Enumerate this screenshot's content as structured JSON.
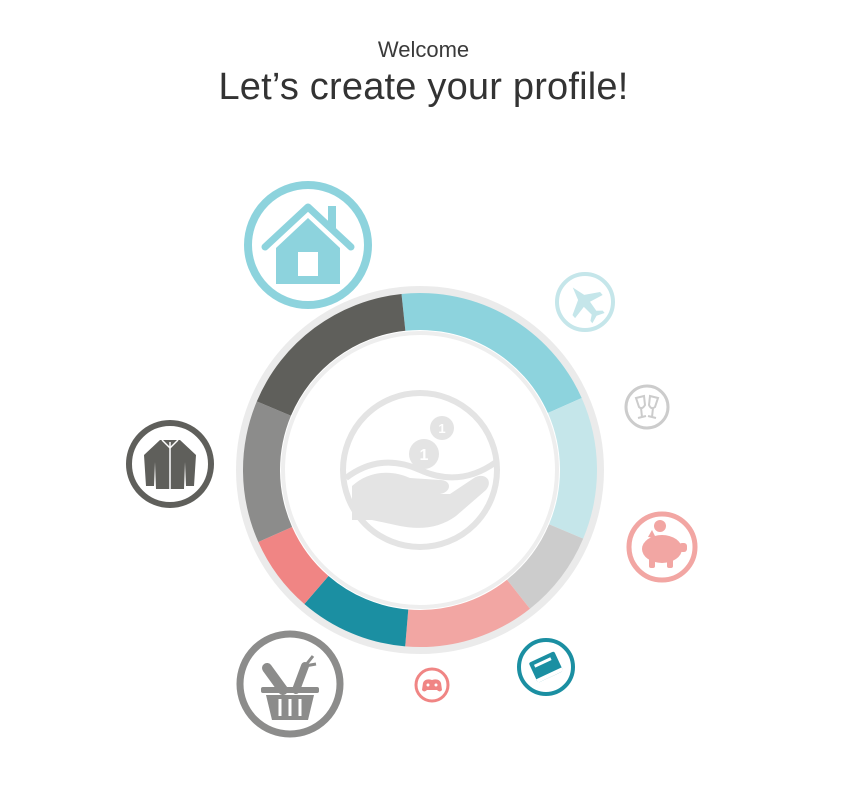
{
  "header": {
    "welcome": "Welcome",
    "title": "Let’s create your profile!"
  },
  "colors": {
    "teal_light": "#8dd3dd",
    "teal_pale": "#c5e6ea",
    "gray_pale": "#cccccc",
    "salmon_light": "#f2a6a3",
    "teal_dark": "#1b8fa2",
    "salmon": "#f08584",
    "gray_mid": "#8c8c8b",
    "gray_dark": "#5f5f5b",
    "ring_track": "#ebebeb",
    "center_icon": "#e4e4e4"
  },
  "categories": [
    {
      "name": "housing",
      "icon": "house-icon",
      "color": "#8dd3dd",
      "share": 0.2
    },
    {
      "name": "travel",
      "icon": "airplane-icon",
      "color": "#c5e6ea",
      "share": 0.13
    },
    {
      "name": "going-out",
      "icon": "champagne-glasses-icon",
      "color": "#cccccc",
      "share": 0.08
    },
    {
      "name": "savings",
      "icon": "piggy-bank-icon",
      "color": "#f2a6a3",
      "share": 0.12
    },
    {
      "name": "education",
      "icon": "book-icon",
      "color": "#1b8fa2",
      "share": 0.1
    },
    {
      "name": "games",
      "icon": "gamepad-icon",
      "color": "#f08584",
      "share": 0.07
    },
    {
      "name": "groceries",
      "icon": "grocery-basket-icon",
      "color": "#8c8c8b",
      "share": 0.13
    },
    {
      "name": "clothing",
      "icon": "jacket-icon",
      "color": "#5f5f5b",
      "share": 0.17
    }
  ],
  "center": {
    "icon": "hand-holding-coins-icon",
    "coin_label": "1"
  }
}
